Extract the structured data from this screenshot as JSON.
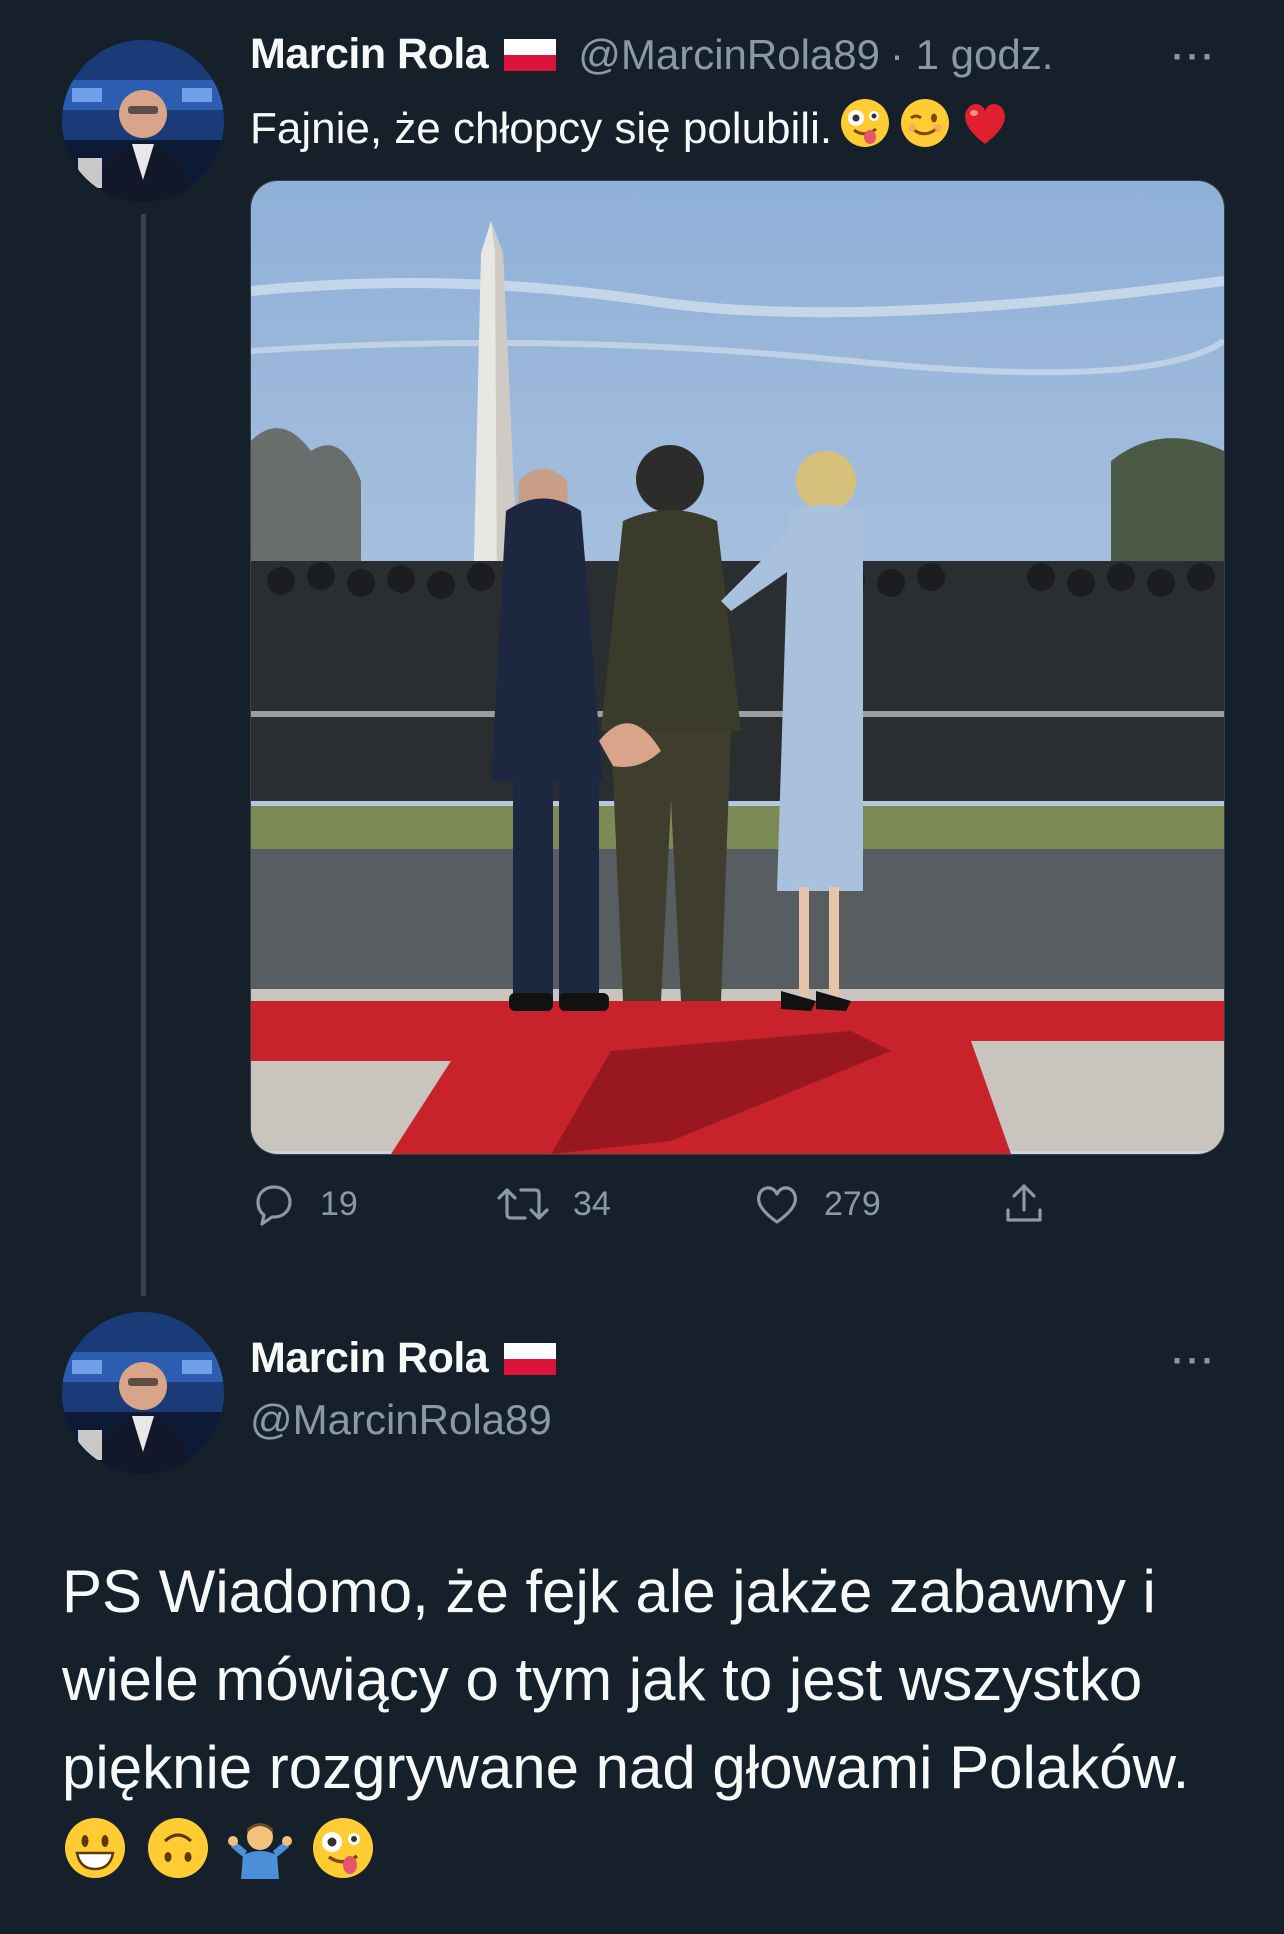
{
  "tweet1": {
    "author_name": "Marcin Rola",
    "handle": "@MarcinRola89",
    "time": "· 1 godz.",
    "text": "Fajnie, że chłopcy się polubili.",
    "text_emojis": [
      "zany-face",
      "winking-face",
      "red-heart"
    ],
    "replies": "19",
    "retweets": "34",
    "likes": "279",
    "more": "···"
  },
  "tweet2": {
    "author_name": "Marcin Rola",
    "handle": "@MarcinRola89",
    "more": "···",
    "text": "PS Wiadomo, że fejk ale jakże zabawny i wiele mówiący o tym jak to jest wszystko pięknie rozgrywane nad głowami Polaków.",
    "text_emojis": [
      "grinning-face",
      "upside-down-face",
      "man-shrugging",
      "zany-face"
    ]
  },
  "colors": {
    "background": "#15202b",
    "text": "#f7f9f9",
    "secondary": "#8b98a5",
    "divider": "#38444d"
  },
  "icons": [
    "reply-icon",
    "retweet-icon",
    "like-icon",
    "share-icon",
    "more-icon",
    "flag-poland-icon"
  ]
}
